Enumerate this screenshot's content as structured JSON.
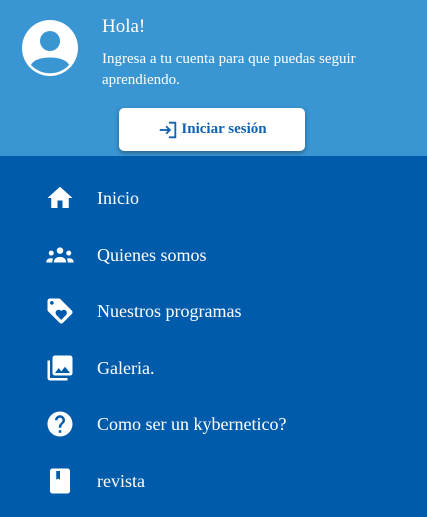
{
  "header": {
    "greeting": "Hola!",
    "subtitle": "Ingresa a tu cuenta para que puedas seguir aprendiendo.",
    "login_label": "Iniciar sesión"
  },
  "menu": {
    "items": [
      {
        "label": "Inicio",
        "icon": "home-icon"
      },
      {
        "label": "Quienes somos",
        "icon": "people-icon"
      },
      {
        "label": "Nuestros programas",
        "icon": "tag-heart-icon"
      },
      {
        "label": "Galeria.",
        "icon": "photo-library-icon"
      },
      {
        "label": "Como ser un kybernetico?",
        "icon": "help-icon"
      },
      {
        "label": "revista",
        "icon": "book-icon"
      }
    ]
  },
  "colors": {
    "header_bg": "#3a95d3",
    "menu_bg": "#005baa",
    "button_text": "#1262b0"
  }
}
